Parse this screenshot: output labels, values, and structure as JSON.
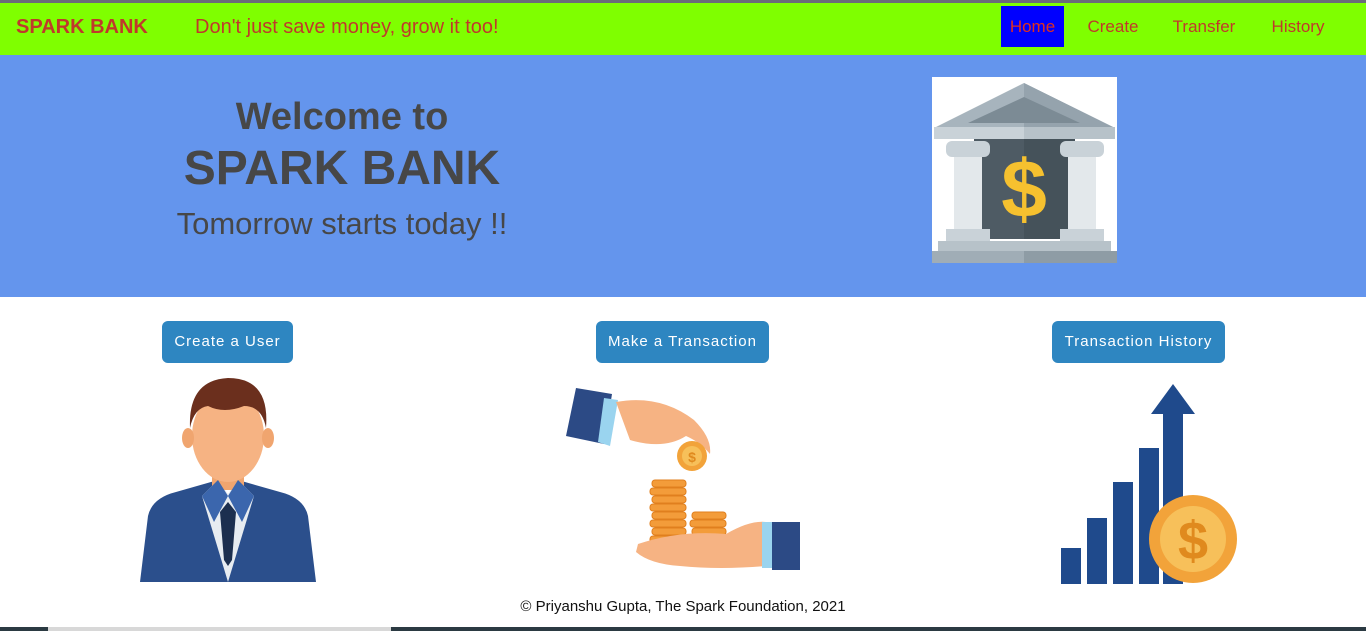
{
  "navbar": {
    "brand": "SPARK BANK",
    "tagline": "Don't just save money, grow it too!",
    "items": [
      {
        "label": "Home",
        "active": true
      },
      {
        "label": "Create"
      },
      {
        "label": "Transfer"
      },
      {
        "label": "History"
      }
    ]
  },
  "hero": {
    "line1": "Welcome to",
    "line2": "SPARK BANK",
    "line3": "Tomorrow starts today !!",
    "image_icon": "bank-building-dollar-icon"
  },
  "actions": [
    {
      "label": "Create a User",
      "icon": "businessman-icon"
    },
    {
      "label": "Make a Transaction",
      "icon": "hand-giving-coins-icon"
    },
    {
      "label": "Transaction History",
      "icon": "growth-chart-coin-icon"
    }
  ],
  "footer": {
    "text": "© Priyanshu Gupta, The Spark Foundation, 2021"
  },
  "colors": {
    "navbar_bg": "#7fff00",
    "nav_text": "#c0392b",
    "active_nav_bg": "#0000ff",
    "hero_bg": "#6495ed",
    "hero_text": "#474747",
    "button_bg": "#2e86c1"
  }
}
